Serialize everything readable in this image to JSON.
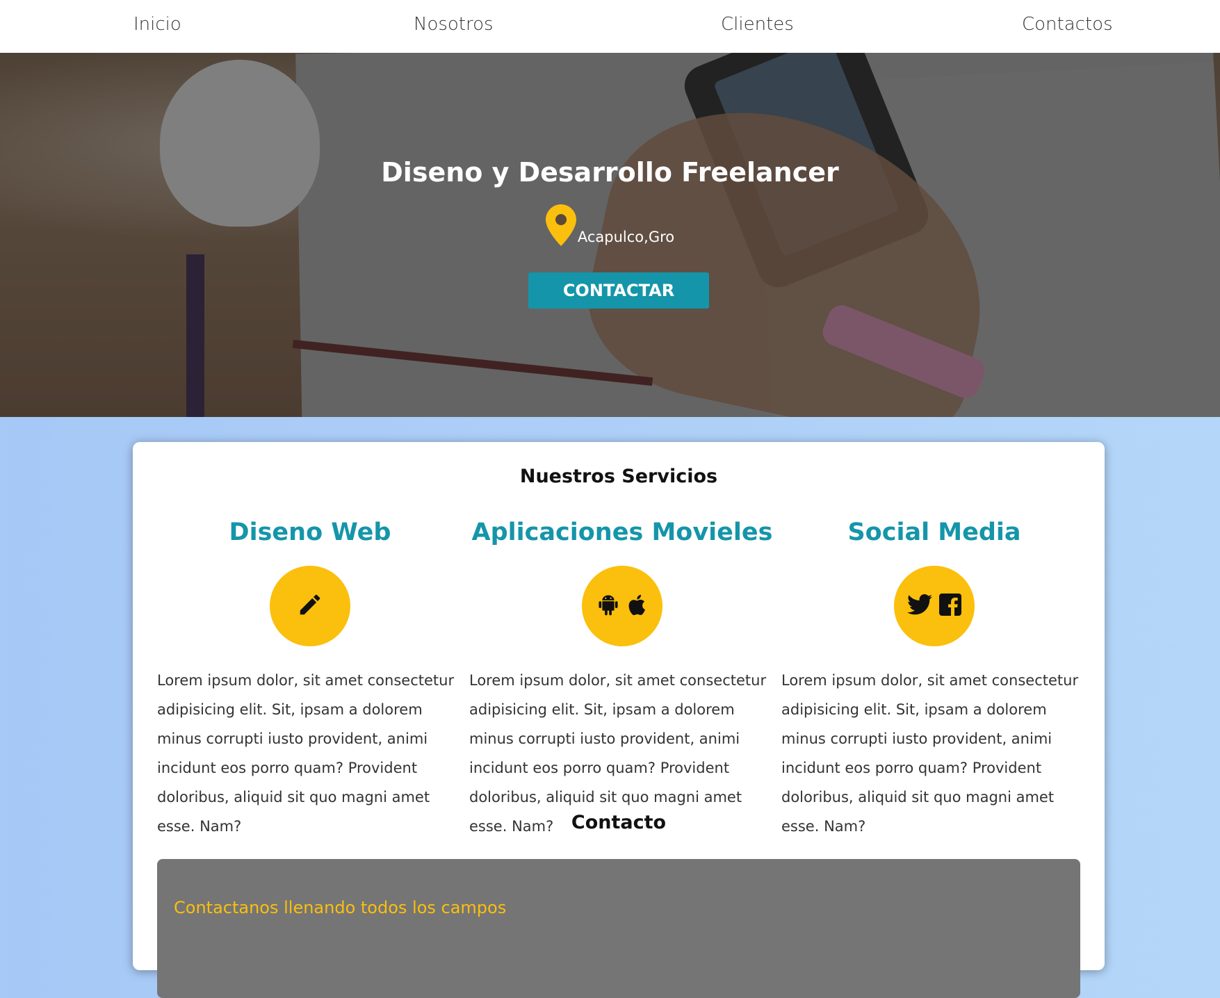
{
  "nav": {
    "items": [
      {
        "label": "Inicio"
      },
      {
        "label": "Nosotros"
      },
      {
        "label": "Clientes"
      },
      {
        "label": "Contactos"
      }
    ]
  },
  "hero": {
    "title": "Diseno y Desarrollo Freelancer",
    "location": "Acapulco,Gro",
    "location_icon": "map-pin-icon",
    "cta_label": "CONTACTAR"
  },
  "services": {
    "title": "Nuestros Servicios",
    "items": [
      {
        "title": "Diseno Web",
        "icons": [
          "pencil-icon"
        ],
        "text": "Lorem ipsum dolor, sit amet consectetur adipisicing elit. Sit, ipsam a dolorem minus corrupti iusto provident, animi incidunt eos porro quam? Provident doloribus, aliquid sit quo magni amet esse. Nam?"
      },
      {
        "title": "Aplicaciones Movieles",
        "icons": [
          "android-icon",
          "apple-icon"
        ],
        "text": "Lorem ipsum dolor, sit amet consectetur adipisicing elit. Sit, ipsam a dolorem minus corrupti iusto provident, animi incidunt eos porro quam? Provident doloribus, aliquid sit quo magni amet esse. Nam?"
      },
      {
        "title": "Social Media",
        "icons": [
          "twitter-icon",
          "facebook-icon"
        ],
        "text": "Lorem ipsum dolor, sit amet consectetur adipisicing elit. Sit, ipsam a dolorem minus corrupti iusto provident, animi incidunt eos porro quam? Provident doloribus, aliquid sit quo magni amet esse. Nam?"
      }
    ]
  },
  "contact": {
    "title": "Contacto",
    "hint": "Contactanos llenando todos los campos"
  },
  "colors": {
    "accent": "#1595a9",
    "icon_circle": "#fbbf0d",
    "hint": "#fbbf0d",
    "contact_box": "#757575"
  }
}
